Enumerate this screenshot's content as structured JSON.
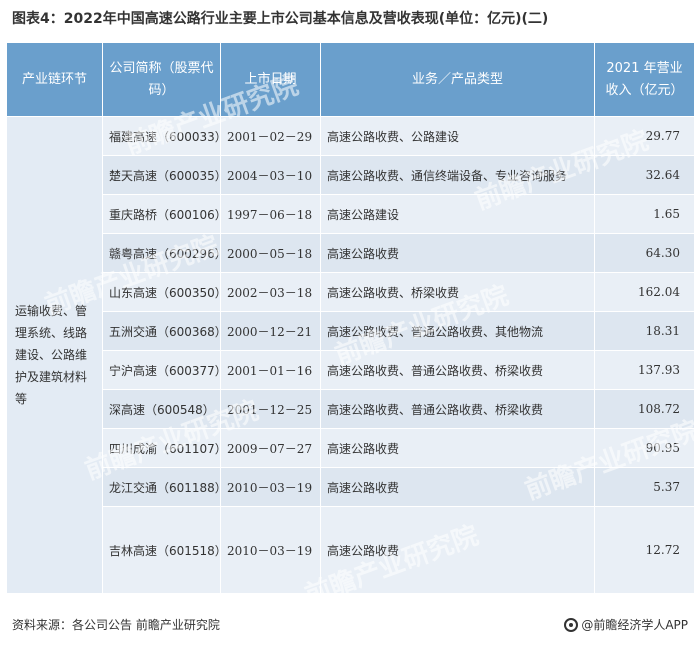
{
  "title": "图表4：2022年中国高速公路行业主要上市公司基本信息及营收表现(单位：亿元)(二)",
  "table": {
    "headers": {
      "segment": "产业链环节",
      "company": "公司简称（股票代码）",
      "date": "上市日期",
      "business": "业务／产品类型",
      "revenue": "2021 年营业收入（亿元）"
    },
    "segment_value": "运输收费、管理系统、线路建设、公路维护及建筑材料等",
    "rows": [
      {
        "company": "福建高速（600033）",
        "date": "2001－02－29",
        "business": "高速公路收费、公路建设",
        "revenue": "29.77"
      },
      {
        "company": "楚天高速（600035）",
        "date": "2004－03－10",
        "business": "高速公路收费、通信终端设备、专业咨询服务",
        "revenue": "32.64"
      },
      {
        "company": "重庆路桥（600106）",
        "date": "1997－06－18",
        "business": "高速公路建设",
        "revenue": "1.65"
      },
      {
        "company": "赣粤高速（600296）",
        "date": "2000－05－18",
        "business": "高速公路收费",
        "revenue": "64.30"
      },
      {
        "company": "山东高速（600350）",
        "date": "2002－03－18",
        "business": "高速公路收费、桥梁收费",
        "revenue": "162.04"
      },
      {
        "company": "五洲交通（600368）",
        "date": "2000－12－21",
        "business": "高速公路收费、普通公路收费、其他物流",
        "revenue": "18.31"
      },
      {
        "company": "宁沪高速（600377）",
        "date": "2001－01－16",
        "business": "高速公路收费、普通公路收费、桥梁收费",
        "revenue": "137.93"
      },
      {
        "company": "深高速（600548）",
        "date": "2001－12－25",
        "business": "高速公路收费、普通公路收费、桥梁收费",
        "revenue": "108.72"
      },
      {
        "company": "四川成渝（601107）",
        "date": "2009－07－27",
        "business": "高速公路收费",
        "revenue": "90.95"
      },
      {
        "company": "龙江交通（601188）",
        "date": "2010－03－19",
        "business": "高速公路收费",
        "revenue": "5.37"
      },
      {
        "company": "吉林高速（601518）",
        "date": "2010－03－19",
        "business": "高速公路收费",
        "revenue": "12.72"
      }
    ]
  },
  "footer": {
    "source": "资料来源：各公司公告 前瞻产业研究院",
    "brand": "@前瞻经济学人APP"
  },
  "watermark": "前瞻产业研究院",
  "colors": {
    "header_bg": "#6a9fcc",
    "row_bg": "#e9eff6",
    "row_bg_alt": "#dde6f0"
  }
}
